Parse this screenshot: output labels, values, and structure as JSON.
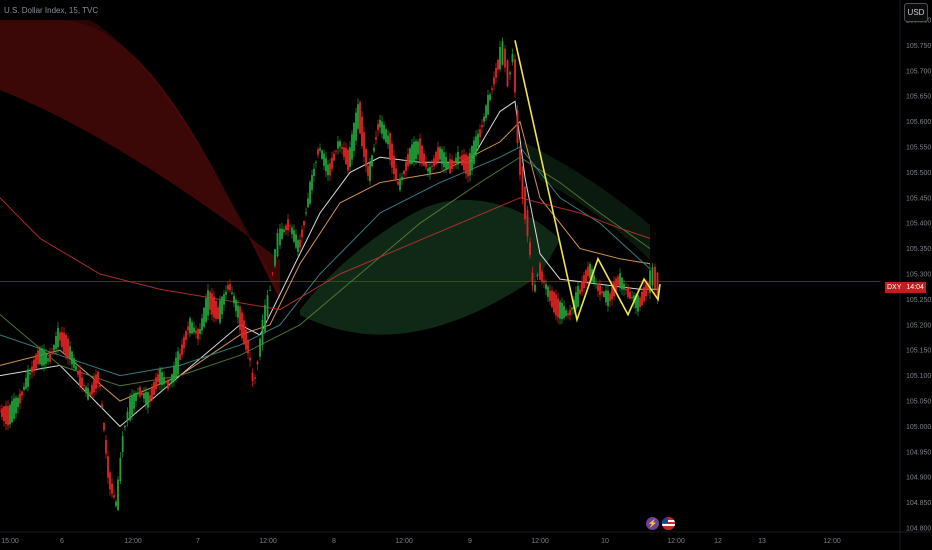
{
  "header": {
    "title": "U.S. Dollar Index, 15, TVC"
  },
  "toolbar": {
    "currency_label": "USD"
  },
  "price_tag": {
    "symbol": "DXY",
    "countdown": "14:04"
  },
  "event_icons": [
    {
      "name": "flash-icon",
      "glyph": "⚡"
    },
    {
      "name": "us-flag-icon",
      "glyph": ""
    }
  ],
  "colors": {
    "background": "#000000",
    "bull_candle": "#1fa23a",
    "bear_candle": "#e02424",
    "price_line": "#b31d1d",
    "pattern_line": "#f2e64a",
    "ma_white": "#f2f2f2",
    "ma_orange": "#e8a35a",
    "ma_teal": "#3a8a8a",
    "ma_green": "#567d34",
    "ma_red": "#c22f2f",
    "red_ribbon": "#5a0b0b",
    "green_ribbon": "#1e4a2a"
  },
  "chart_data": {
    "type": "candlestick",
    "title": "U.S. Dollar Index, 15, TVC",
    "y_axis": {
      "ticks": [
        "105.800",
        "105.750",
        "105.700",
        "105.650",
        "105.600",
        "105.550",
        "105.500",
        "105.450",
        "105.400",
        "105.350",
        "105.300",
        "105.250",
        "105.200",
        "105.150",
        "105.100",
        "105.050",
        "105.000",
        "104.950",
        "104.900",
        "104.850",
        "104.800"
      ],
      "range": [
        104.8,
        105.8
      ]
    },
    "x_axis": {
      "ticks": [
        "15:00",
        "6",
        "12:00",
        "7",
        "12:00",
        "8",
        "12:00",
        "9",
        "12:00",
        "10",
        "12:00",
        "12",
        "13",
        "12:00"
      ]
    },
    "current_price": 105.285,
    "price_path": [
      [
        0,
        105.03
      ],
      [
        10,
        105.02
      ],
      [
        20,
        105.05
      ],
      [
        30,
        105.1
      ],
      [
        40,
        105.14
      ],
      [
        50,
        105.13
      ],
      [
        60,
        105.18
      ],
      [
        70,
        105.15
      ],
      [
        80,
        105.1
      ],
      [
        90,
        105.06
      ],
      [
        100,
        105.1
      ],
      [
        110,
        104.9
      ],
      [
        118,
        104.84
      ],
      [
        125,
        104.99
      ],
      [
        130,
        105.03
      ],
      [
        140,
        105.07
      ],
      [
        150,
        105.05
      ],
      [
        160,
        105.1
      ],
      [
        170,
        105.08
      ],
      [
        180,
        105.13
      ],
      [
        190,
        105.2
      ],
      [
        200,
        105.18
      ],
      [
        210,
        105.25
      ],
      [
        220,
        105.22
      ],
      [
        230,
        105.28
      ],
      [
        240,
        105.22
      ],
      [
        250,
        105.15
      ],
      [
        255,
        105.08
      ],
      [
        260,
        105.14
      ],
      [
        265,
        105.2
      ],
      [
        270,
        105.25
      ],
      [
        275,
        105.32
      ],
      [
        280,
        105.37
      ],
      [
        290,
        105.4
      ],
      [
        300,
        105.35
      ],
      [
        310,
        105.45
      ],
      [
        320,
        105.55
      ],
      [
        330,
        105.5
      ],
      [
        340,
        105.56
      ],
      [
        350,
        105.52
      ],
      [
        360,
        105.62
      ],
      [
        370,
        105.49
      ],
      [
        380,
        105.6
      ],
      [
        390,
        105.56
      ],
      [
        400,
        105.47
      ],
      [
        410,
        105.53
      ],
      [
        420,
        105.55
      ],
      [
        430,
        105.5
      ],
      [
        440,
        105.54
      ],
      [
        450,
        105.51
      ],
      [
        460,
        105.53
      ],
      [
        470,
        105.51
      ],
      [
        480,
        105.57
      ],
      [
        490,
        105.64
      ],
      [
        500,
        105.72
      ],
      [
        505,
        105.74
      ],
      [
        510,
        105.68
      ],
      [
        515,
        105.74
      ],
      [
        520,
        105.54
      ],
      [
        525,
        105.46
      ],
      [
        530,
        105.38
      ],
      [
        535,
        105.26
      ],
      [
        540,
        105.31
      ],
      [
        550,
        105.26
      ],
      [
        560,
        105.23
      ],
      [
        570,
        105.22
      ],
      [
        580,
        105.26
      ],
      [
        590,
        105.31
      ],
      [
        600,
        105.27
      ],
      [
        610,
        105.25
      ],
      [
        620,
        105.29
      ],
      [
        630,
        105.26
      ],
      [
        640,
        105.24
      ],
      [
        650,
        105.28
      ],
      [
        655,
        105.3
      ],
      [
        660,
        105.27
      ]
    ],
    "moving_averages": [
      {
        "color": "#f2f2f2",
        "values": [
          [
            0,
            105.1
          ],
          [
            60,
            105.12
          ],
          [
            120,
            105.0
          ],
          [
            180,
            105.1
          ],
          [
            240,
            105.2
          ],
          [
            260,
            105.18
          ],
          [
            290,
            105.3
          ],
          [
            320,
            105.42
          ],
          [
            350,
            105.5
          ],
          [
            380,
            105.53
          ],
          [
            420,
            105.52
          ],
          [
            470,
            105.52
          ],
          [
            500,
            105.62
          ],
          [
            515,
            105.64
          ],
          [
            525,
            105.49
          ],
          [
            540,
            105.34
          ],
          [
            560,
            105.29
          ],
          [
            600,
            105.28
          ],
          [
            640,
            105.27
          ],
          [
            660,
            105.27
          ]
        ]
      },
      {
        "color": "#e8a35a",
        "values": [
          [
            0,
            105.12
          ],
          [
            60,
            105.15
          ],
          [
            120,
            105.05
          ],
          [
            180,
            105.1
          ],
          [
            240,
            105.18
          ],
          [
            270,
            105.2
          ],
          [
            300,
            105.32
          ],
          [
            340,
            105.44
          ],
          [
            380,
            105.48
          ],
          [
            440,
            105.5
          ],
          [
            500,
            105.56
          ],
          [
            520,
            105.6
          ],
          [
            540,
            105.45
          ],
          [
            580,
            105.35
          ],
          [
            620,
            105.33
          ],
          [
            650,
            105.32
          ]
        ]
      },
      {
        "color": "#3a8a8a",
        "values": [
          [
            0,
            105.18
          ],
          [
            60,
            105.14
          ],
          [
            120,
            105.1
          ],
          [
            180,
            105.12
          ],
          [
            240,
            105.16
          ],
          [
            280,
            105.2
          ],
          [
            320,
            105.3
          ],
          [
            380,
            105.42
          ],
          [
            440,
            105.48
          ],
          [
            500,
            105.53
          ],
          [
            520,
            105.55
          ],
          [
            560,
            105.45
          ],
          [
            600,
            105.4
          ],
          [
            650,
            105.31
          ]
        ]
      },
      {
        "color": "#567d34",
        "values": [
          [
            0,
            105.22
          ],
          [
            60,
            105.12
          ],
          [
            120,
            105.08
          ],
          [
            180,
            105.1
          ],
          [
            240,
            105.14
          ],
          [
            300,
            105.2
          ],
          [
            360,
            105.3
          ],
          [
            420,
            105.4
          ],
          [
            480,
            105.48
          ],
          [
            520,
            105.53
          ],
          [
            560,
            105.48
          ],
          [
            600,
            105.42
          ],
          [
            650,
            105.35
          ]
        ]
      },
      {
        "color": "#c22f2f",
        "values": [
          [
            0,
            105.45
          ],
          [
            40,
            105.37
          ],
          [
            100,
            105.3
          ],
          [
            160,
            105.27
          ],
          [
            220,
            105.25
          ],
          [
            280,
            105.23
          ],
          [
            340,
            105.3
          ],
          [
            400,
            105.35
          ],
          [
            460,
            105.4
          ],
          [
            520,
            105.45
          ],
          [
            580,
            105.42
          ],
          [
            620,
            105.39
          ],
          [
            650,
            105.37
          ]
        ]
      }
    ],
    "pattern": {
      "color": "#f2e64a",
      "points": [
        [
          515,
          105.76
        ],
        [
          577,
          105.21
        ],
        [
          598,
          105.33
        ],
        [
          628,
          105.22
        ],
        [
          644,
          105.29
        ],
        [
          658,
          105.25
        ],
        [
          660,
          105.28
        ]
      ]
    }
  }
}
